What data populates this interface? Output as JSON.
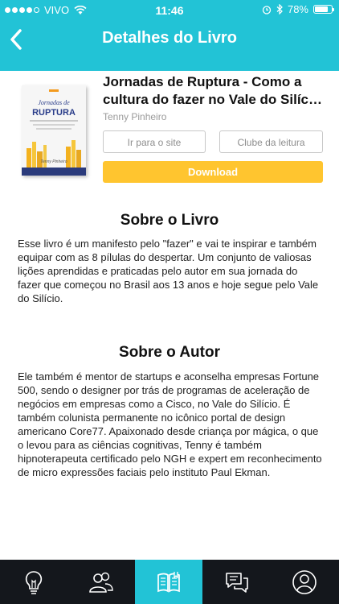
{
  "status_bar": {
    "carrier": "VIVO",
    "time": "11:46",
    "battery": "78%",
    "battery_level": 0.78
  },
  "nav": {
    "title": "Detalhes do Livro",
    "back_icon": "chevron-left-icon"
  },
  "book": {
    "title": "Jornadas de Ruptura - Como a cultura do fazer no Vale do Silício mudou minha vida",
    "author": "Tenny Pinheiro",
    "cover": {
      "top_label": "Jornadas de",
      "main_label": "RUPTURA",
      "author_label": "Tenny Pinheiro"
    },
    "buttons": {
      "site": "Ir para o site",
      "club": "Clube da leitura",
      "download": "Download"
    }
  },
  "about_book": {
    "heading": "Sobre o Livro",
    "text": "Esse livro é um manifesto pelo \"fazer\" e vai te inspirar e também equipar com as 8 pílulas do despertar. Um conjunto de valiosas lições aprendidas e praticadas pelo autor em sua jornada do fazer que começou no Brasil aos 13 anos e hoje segue pelo Vale do Silício."
  },
  "about_author": {
    "heading": "Sobre o Autor",
    "text": "Ele também é mentor de startups e aconselha empresas Fortune 500, sendo o designer por trás de programas de aceleração de negócios em empresas como a Cisco, no Vale do Silício. É também colunista permanente no icônico portal de design americano Core77. Apaixonado desde criança por mágica, o que o levou para as ciências cognitivas, Tenny é também hipnoterapeuta certificado pelo NGH e expert em reconhecimento de micro expressões faciais pelo instituto Paul Ekman."
  },
  "tab_bar": {
    "tabs": [
      {
        "icon": "lightbulb-icon",
        "active": false
      },
      {
        "icon": "people-icon",
        "active": false
      },
      {
        "icon": "book-icon",
        "active": true
      },
      {
        "icon": "chat-icon",
        "active": false
      },
      {
        "icon": "profile-icon",
        "active": false
      }
    ]
  },
  "colors": {
    "accent": "#22c3d6",
    "download": "#ffc52f",
    "tabbar": "#14171c"
  }
}
